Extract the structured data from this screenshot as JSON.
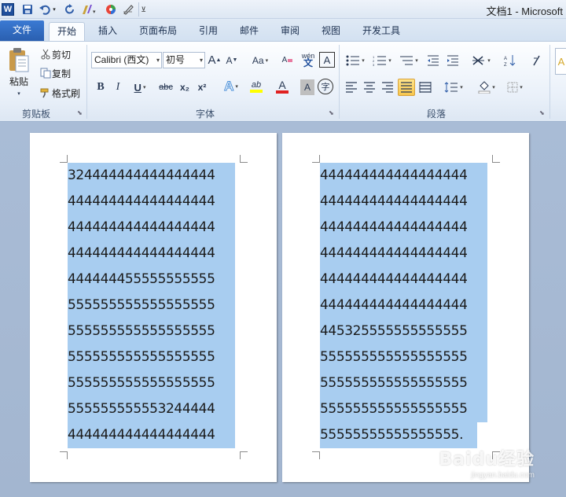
{
  "window": {
    "title": "文档1 - Microsoft"
  },
  "quick_access": {
    "app_icon": "W",
    "icons": [
      "save-icon",
      "undo-icon",
      "redo-icon",
      "format-painter-icon",
      "color-wheel-icon",
      "pen-icon",
      "customize-icon"
    ]
  },
  "tabs": [
    {
      "label": "文件"
    },
    {
      "label": "开始"
    },
    {
      "label": "插入"
    },
    {
      "label": "页面布局"
    },
    {
      "label": "引用"
    },
    {
      "label": "邮件"
    },
    {
      "label": "审阅"
    },
    {
      "label": "视图"
    },
    {
      "label": "开发工具"
    }
  ],
  "clipboard": {
    "paste_label": "粘贴",
    "cut_label": "剪切",
    "copy_label": "复制",
    "format_painter_label": "格式刷",
    "group_label": "剪贴板"
  },
  "font": {
    "font_name": "Calibri (西文)",
    "font_size": "初号",
    "bold_label": "B",
    "italic_label": "I",
    "underline_label": "U",
    "strike_label": "abc",
    "subscript_label": "x₂",
    "superscript_label": "x²",
    "grow_label": "A",
    "shrink_label": "A",
    "change_case_label": "Aa",
    "clear_format_label": "A",
    "phonetic_label": "wén",
    "border_char_label": "A",
    "text_effect_label": "A",
    "highlight_label": "ab",
    "font_color_label": "A",
    "char_shading_label": "A",
    "enclose_label": "字",
    "group_label": "字体",
    "colors": {
      "highlight": "#ffff00",
      "font_color": "#e02020",
      "text_effect": "#4a8fd8"
    }
  },
  "paragraph": {
    "group_label": "段落"
  },
  "document": {
    "page1_lines": [
      "324444444444444444",
      "444444444444444444",
      "444444444444444444",
      "444444444444444444",
      "444444455555555555",
      "555555555555555555",
      "555555555555555555",
      "555555555555555555",
      "555555555555555555",
      "555555555553244444",
      "444444444444444444"
    ],
    "page2_lines": [
      "444444444444444444",
      "444444444444444444",
      "444444444444444444",
      "444444444444444444",
      "444444444444444444",
      "444444444444444444",
      "445325555555555555",
      "555555555555555555",
      "555555555555555555",
      "555555555555555555",
      "55555555555555555."
    ],
    "selection_color": "#a8cdf0"
  },
  "watermark": {
    "logo": "Baidu经验",
    "url": "jingyan.baidu.com"
  }
}
